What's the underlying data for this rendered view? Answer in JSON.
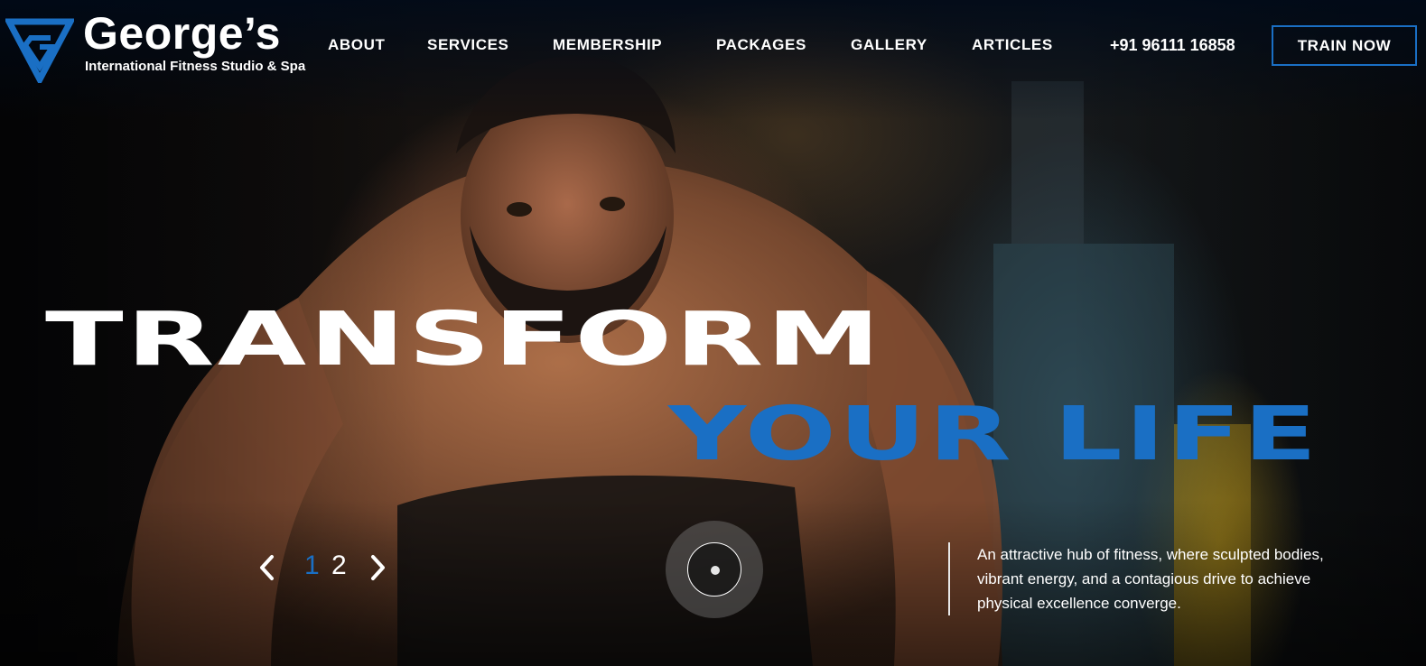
{
  "brand": {
    "name": "George’s",
    "subtitle": "International Fitness Studio & Spa",
    "accent_color": "#1a6fc4"
  },
  "nav": {
    "items": [
      "ABOUT",
      "SERVICES",
      "MEMBERSHIP",
      "PACKAGES",
      "GALLERY",
      "ARTICLES"
    ],
    "phone": "+91 96111 16858",
    "cta_label": "TRAIN NOW"
  },
  "hero": {
    "headline_line1": "TRANSFORM",
    "headline_line2": "YOUR LIFE",
    "tagline": "An attractive hub of fitness, where sculpted bodies, vibrant energy, and a contagious drive to achieve physical excellence converge.",
    "slider": {
      "pages": [
        "1",
        "2"
      ],
      "current_page": "1",
      "prev_icon": "chevron-left-icon",
      "next_icon": "chevron-right-icon"
    },
    "scroll_icon": "scroll-indicator-icon"
  }
}
